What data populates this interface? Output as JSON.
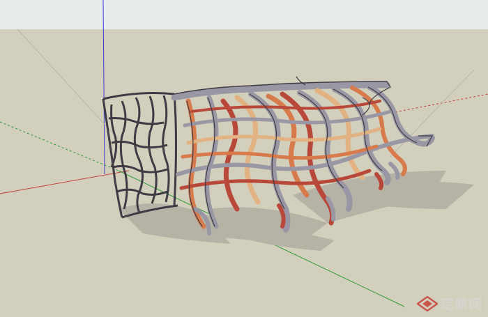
{
  "app": {
    "title": ""
  },
  "scene": {
    "sky_color": "#e6ebec",
    "ground_color": "#d3cfbd",
    "axis_red": "#c0403a",
    "axis_green": "#2f9a3a",
    "axis_blue": "#3b3bd0",
    "model_outline": "#3f3b44",
    "model_fill_gray": "#9a97a4",
    "model_fill_orange": "#d77a4c",
    "model_fill_red": "#b8483a",
    "model_fill_tan": "#e3b283",
    "shadow_color": "#b6b3a6",
    "model_name": "sculptural-lattice-pavilion"
  },
  "watermark": {
    "text": "定鼎网",
    "logo_icon": "diamond-logo-icon",
    "color": "#d8d6d2",
    "logo_color": "#c9413a"
  }
}
